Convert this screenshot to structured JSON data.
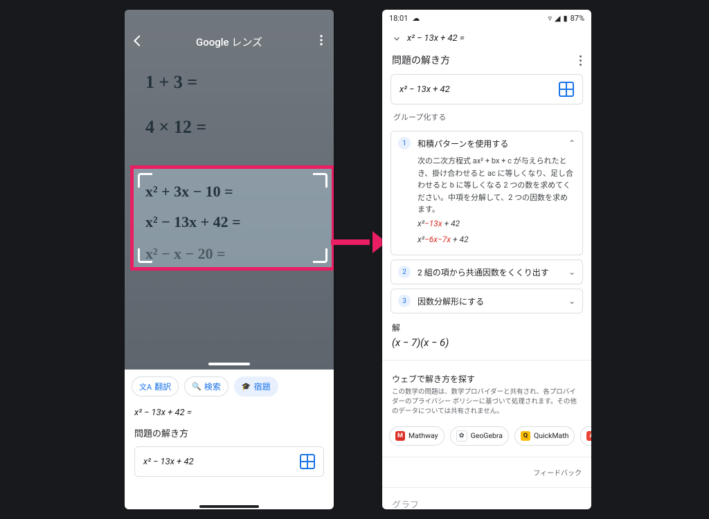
{
  "status": {
    "time": "18:01",
    "battery": "87%"
  },
  "left": {
    "title": "Google レンズ",
    "handwriting": {
      "l1": "1 + 3 =",
      "l2": "4 × 12 =",
      "l3": "x² + 3x − 10 =",
      "l4": "x² − 13x + 42 =",
      "l5": "x² − x − 20 ="
    },
    "chips": {
      "translate": "翻訳",
      "search": "検索",
      "homework": "宿題"
    },
    "detected": "x² − 13x + 42 =",
    "howto_label": "問題の解き方",
    "equation_input": "x² − 13x + 42"
  },
  "right": {
    "collapsed_equation": "x² − 13x + 42 =",
    "howto_label": "問題の解き方",
    "equation_input": "x² − 13x + 42",
    "group_label": "グループ化する",
    "steps": [
      {
        "num": "1",
        "title": "和積パターンを使用する",
        "body": "次の二次方程式 ax² + bx + c が与えられたとき、掛け合わせると ac に等しくなり、足し合わせると b に等しくなる 2 つの数を求めてください。中項を分解して、2 つの因数を求めます。",
        "math1_plain": "x²",
        "math1_red": "−13x",
        "math1_tail": " + 42",
        "math2_plain": "x²",
        "math2_red": "−6x−7x",
        "math2_tail": " + 42",
        "expanded": true
      },
      {
        "num": "2",
        "title": "2 組の項から共通因数をくくり出す",
        "expanded": false
      },
      {
        "num": "3",
        "title": "因数分解形にする",
        "expanded": false
      }
    ],
    "solution_label": "解",
    "solution": "(x − 7)(x − 6)",
    "web_label": "ウェブで解き方を探す",
    "disclaimer": "この数学の問題は、数学プロバイダーと共有され、各プロバイダーのプライバシー ポリシーに基づいて処理されます。その他のデータについては共有されません。",
    "providers": [
      {
        "name": "Mathway",
        "badge_bg": "#d93025",
        "badge": "M"
      },
      {
        "name": "GeoGebra",
        "badge_bg": "#ffffff",
        "badge": "✿",
        "badge_fg": "#5f6368"
      },
      {
        "name": "QuickMath",
        "badge_bg": "#fbbc04",
        "badge": "Q",
        "badge_fg": "#202124"
      },
      {
        "name": "A…",
        "badge_bg": "#ea4335",
        "badge": "A"
      }
    ],
    "feedback": "フィードバック",
    "bottom_cut": "グラフ"
  }
}
